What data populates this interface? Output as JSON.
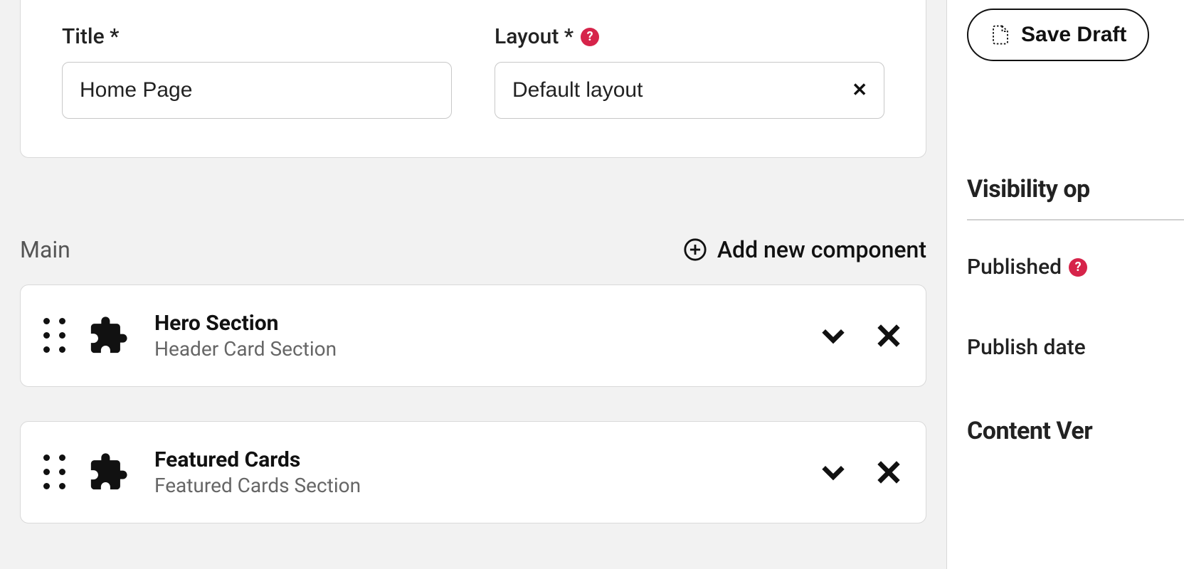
{
  "form": {
    "title_label": "Title *",
    "title_value": "Home Page",
    "layout_label": "Layout *",
    "layout_value": "Default layout"
  },
  "section": {
    "heading": "Main",
    "add_label": "Add new component",
    "components": [
      {
        "title": "Hero Section",
        "subtitle": "Header Card Section"
      },
      {
        "title": "Featured Cards",
        "subtitle": "Featured Cards Section"
      }
    ]
  },
  "sidebar": {
    "save_draft": "Save Draft",
    "visibility_heading": "Visibility op",
    "published_label": "Published",
    "publish_date_label": "Publish date",
    "content_ver_heading": "Content Ver"
  }
}
